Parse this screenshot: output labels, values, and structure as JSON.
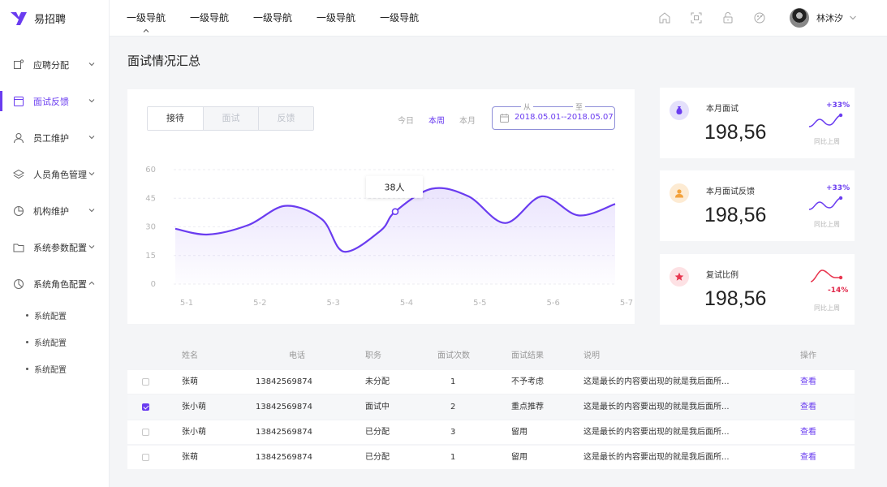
{
  "app": {
    "name": "易招聘"
  },
  "sidebar": {
    "items": [
      {
        "label": "应聘分配",
        "icon": "message-square-icon"
      },
      {
        "label": "面试反馈",
        "icon": "window-icon",
        "active": true
      },
      {
        "label": "员工维护",
        "icon": "user-icon"
      },
      {
        "label": "人员角色管理",
        "icon": "layers-icon"
      },
      {
        "label": "机构维护",
        "icon": "pie-chart-icon"
      },
      {
        "label": "系统参数配置",
        "icon": "folder-icon"
      },
      {
        "label": "系统角色配置",
        "icon": "clock-pie-icon",
        "expanded": true
      }
    ],
    "subitems": [
      "系统配置",
      "系统配置",
      "系统配置"
    ]
  },
  "topnav": {
    "items": [
      "一级导航",
      "一级导航",
      "一级导航",
      "一级导航",
      "一级导航"
    ],
    "active_index": 0
  },
  "header_icons": [
    "home-icon",
    "scan-icon",
    "lock-icon",
    "palette-icon"
  ],
  "user": {
    "name": "林沐汐"
  },
  "page": {
    "title": "面试情况汇总"
  },
  "chart_panel": {
    "segments": [
      "接待",
      "面试",
      "反馈"
    ],
    "active_segment": 0,
    "ranges": [
      "今日",
      "本周",
      "本月"
    ],
    "active_range": 1,
    "date_from_label": "从",
    "date_to_label": "至",
    "date_range": "2018.05.01--2018.05.07",
    "tooltip": "38人"
  },
  "chart_data": {
    "type": "area",
    "categories": [
      "5-1",
      "5-2",
      "5-3",
      "5-4",
      "5-5",
      "5-6",
      "5-7"
    ],
    "x": [
      0,
      0.5,
      1,
      1.5,
      2,
      2.5,
      3,
      3.5,
      4,
      4.5,
      5,
      5.5,
      6
    ],
    "values": [
      29,
      26,
      31,
      41,
      33,
      17,
      28,
      38,
      50,
      46,
      32,
      43,
      46,
      36,
      42
    ],
    "series": [
      {
        "points": [
          [
            0,
            29
          ],
          [
            0.45,
            26
          ],
          [
            1,
            31
          ],
          [
            1.5,
            41
          ],
          [
            2,
            34
          ],
          [
            2.3,
            17
          ],
          [
            2.8,
            28
          ],
          [
            3,
            38
          ],
          [
            3.5,
            50
          ],
          [
            4,
            46
          ],
          [
            4.5,
            32
          ],
          [
            5,
            46
          ],
          [
            5.5,
            36
          ],
          [
            6,
            42
          ]
        ]
      }
    ],
    "highlight": {
      "x": 3,
      "y": 38,
      "label": "38人"
    },
    "ylim": [
      0,
      60
    ],
    "yticks": [
      0,
      15,
      30,
      45,
      60
    ],
    "grid": true,
    "line_color": "#6a3cf0"
  },
  "stats": [
    {
      "label": "本月面试",
      "value": "198,56",
      "change": "+33%",
      "trend": "up",
      "caption": "同比上周",
      "icon": "money-bag-icon",
      "icon_bg": "#e4e0fb",
      "icon_color": "#6a3cf0"
    },
    {
      "label": "本月面试反馈",
      "value": "198,56",
      "change": "+33%",
      "trend": "up",
      "caption": "同比上周",
      "icon": "user-icon",
      "icon_bg": "#fdebd3",
      "icon_color": "#f3a23c"
    },
    {
      "label": "复试比例",
      "value": "198,56",
      "change": "-14%",
      "trend": "down",
      "caption": "同比上周",
      "icon": "star-icon",
      "icon_bg": "#fde1e4",
      "icon_color": "#e8364f"
    }
  ],
  "table": {
    "headers": [
      "姓名",
      "电话",
      "职务",
      "面试次数",
      "面试结果",
      "说明",
      "操作"
    ],
    "rows": [
      {
        "checked": false,
        "name": "张萌",
        "phone": "13842569874",
        "role": "未分配",
        "count": "1",
        "result": "不予考虑",
        "note": "这是最长的内容要出现的就是我后面所...",
        "action": "查看"
      },
      {
        "checked": true,
        "name": "张小萌",
        "phone": "13842569874",
        "role": "面试中",
        "count": "2",
        "result": "重点推荐",
        "note": "这是最长的内容要出现的就是我后面所...",
        "action": "查看"
      },
      {
        "checked": false,
        "name": "张小萌",
        "phone": "13842569874",
        "role": "已分配",
        "count": "3",
        "result": "留用",
        "note": "这是最长的内容要出现的就是我后面所...",
        "action": "查看"
      },
      {
        "checked": false,
        "name": "张萌",
        "phone": "13842569874",
        "role": "已分配",
        "count": "1",
        "result": "留用",
        "note": "这是最长的内容要出现的就是我后面所...",
        "action": "查看"
      }
    ]
  }
}
